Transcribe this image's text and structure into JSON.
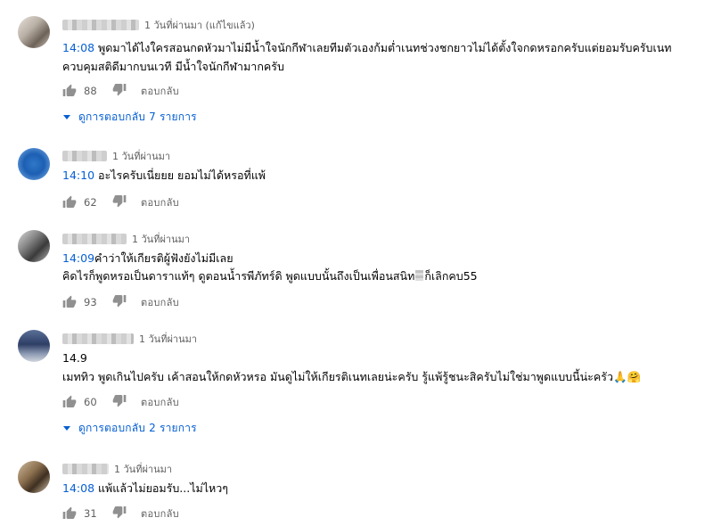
{
  "comments": [
    {
      "time": "1 วันที่ผ่านมา (แก้ไขแล้ว)",
      "timestamp": "14:08",
      "line1": " พูดมาได้ไงใครสอนกดหัวมาไม่มีน้ำใจนักกีฬาเลยทีมตัวเองก้มต่ำเนทช่วงชกยาวไม่ได้ตั้งใจกดหรอกครับแต่ยอมรับครับเนท",
      "line2": "ควบคุมสติดีมากบนเวที มีน้ำใจนักกีฬามากครับ",
      "likes": "88",
      "reply_label": "ตอบกลับ",
      "view_replies": "ดูการตอบกลับ 7 รายการ"
    },
    {
      "time": "1 วันที่ผ่านมา",
      "timestamp": "14:10",
      "line1": " อะไรครับเนี่ยยย ยอมไม่ได้หรอที่แพ้",
      "likes": "62",
      "reply_label": "ตอบกลับ"
    },
    {
      "time": "1 วันที่ผ่านมา",
      "timestamp": "14:09",
      "line1": "คำว่าให้เกียรติผู้ฟังยังไม่มีเลย",
      "line2a": "คิดไรก็พูดหรอเป็นดาราแท้ๆ ดูตอนน้ำรพีภัทร์ดิ  พูดแบบนั้นถึงเป็นเพื่อนสนิท",
      "line2b": "ก็เลิกคบ55",
      "likes": "93",
      "reply_label": "ตอบกลับ"
    },
    {
      "time": "1 วันที่ผ่านมา",
      "line1": "14.9",
      "line2": "เมททิว พูดเกินไปครับ เค้าสอนให้กดหัวหรอ มันดูไม่ให้เกียรติเนทเลยน่ะครับ รู้แพ้รู้ชนะสิครับไม่ใช่มาพูดแบบนี้น่ะครัว🙏🤗",
      "likes": "60",
      "reply_label": "ตอบกลับ",
      "view_replies": "ดูการตอบกลับ 2 รายการ"
    },
    {
      "time": "1 วันที่ผ่านมา",
      "timestamp": "14:08",
      "line1": " แพ้แล้วไม่ยอมรับ...ไม่ไหวๆ",
      "likes": "31",
      "reply_label": "ตอบกลับ"
    }
  ],
  "icons": {
    "like": "thumbs-up-icon",
    "dislike": "thumbs-down-icon",
    "expand": "caret-down-icon"
  },
  "colors": {
    "link": "#065fd4",
    "meta": "#606060",
    "text": "#030303"
  }
}
